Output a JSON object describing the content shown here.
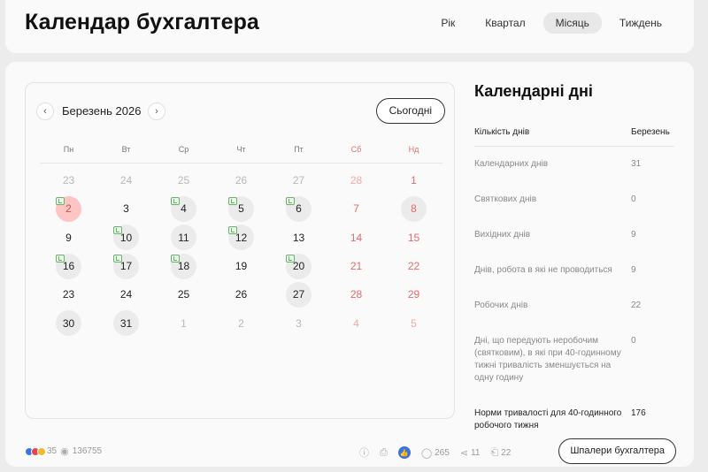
{
  "header": {
    "title": "Календар бухгалтера",
    "tabs": [
      {
        "label": "Рік",
        "active": false
      },
      {
        "label": "Квартал",
        "active": false
      },
      {
        "label": "Місяць",
        "active": true
      },
      {
        "label": "Тиждень",
        "active": false
      }
    ]
  },
  "calendar": {
    "month_label": "Березень 2026",
    "prev_icon": "‹",
    "next_icon": "›",
    "today_label": "Сьогодні",
    "weekdays": [
      {
        "label": "Пн",
        "weekend": false
      },
      {
        "label": "Вт",
        "weekend": false
      },
      {
        "label": "Ср",
        "weekend": false
      },
      {
        "label": "Чт",
        "weekend": false
      },
      {
        "label": "Пт",
        "weekend": false
      },
      {
        "label": "Сб",
        "weekend": true
      },
      {
        "label": "Нд",
        "weekend": true
      }
    ],
    "weeks": [
      [
        {
          "d": "23",
          "other": true
        },
        {
          "d": "24",
          "other": true
        },
        {
          "d": "25",
          "other": true
        },
        {
          "d": "26",
          "other": true
        },
        {
          "d": "27",
          "other": true
        },
        {
          "d": "28",
          "other": true,
          "weekend": true
        },
        {
          "d": "1",
          "weekend": true
        }
      ],
      [
        {
          "d": "2",
          "selected": true,
          "mark": true
        },
        {
          "d": "3"
        },
        {
          "d": "4",
          "shaded": true,
          "mark": true
        },
        {
          "d": "5",
          "shaded": true,
          "mark": true
        },
        {
          "d": "6",
          "shaded": true,
          "mark": true
        },
        {
          "d": "7",
          "weekend": true
        },
        {
          "d": "8",
          "weekend": true,
          "shaded": true
        }
      ],
      [
        {
          "d": "9"
        },
        {
          "d": "10",
          "shaded": true,
          "mark": true
        },
        {
          "d": "11",
          "shaded": true
        },
        {
          "d": "12",
          "shaded": true,
          "mark": true
        },
        {
          "d": "13"
        },
        {
          "d": "14",
          "weekend": true
        },
        {
          "d": "15",
          "weekend": true
        }
      ],
      [
        {
          "d": "16",
          "shaded": true,
          "mark": true
        },
        {
          "d": "17",
          "shaded": true,
          "mark": true
        },
        {
          "d": "18",
          "shaded": true,
          "mark": true
        },
        {
          "d": "19"
        },
        {
          "d": "20",
          "shaded": true,
          "mark": true
        },
        {
          "d": "21",
          "weekend": true
        },
        {
          "d": "22",
          "weekend": true
        }
      ],
      [
        {
          "d": "23"
        },
        {
          "d": "24"
        },
        {
          "d": "25"
        },
        {
          "d": "26"
        },
        {
          "d": "27",
          "shaded": true
        },
        {
          "d": "28",
          "weekend": true
        },
        {
          "d": "29",
          "weekend": true
        }
      ],
      [
        {
          "d": "30",
          "shaded": true
        },
        {
          "d": "31",
          "shaded": true
        },
        {
          "d": "1",
          "other": true
        },
        {
          "d": "2",
          "other": true
        },
        {
          "d": "3",
          "other": true
        },
        {
          "d": "4",
          "other": true,
          "weekend": true
        },
        {
          "d": "5",
          "other": true,
          "weekend": true
        }
      ]
    ]
  },
  "sidebar": {
    "title": "Календарні дні",
    "col_label": "Кількість днів",
    "col_month": "Березень",
    "rows": [
      {
        "label": "Календарних днів",
        "value": "31",
        "bold": false
      },
      {
        "label": "Святкових днів",
        "value": "0",
        "bold": false
      },
      {
        "label": "Вихідних днів",
        "value": "9",
        "bold": false
      },
      {
        "label": "Днів, робота в які не проводиться",
        "value": "9",
        "bold": false
      },
      {
        "label": "Робочих днів",
        "value": "22",
        "bold": false
      },
      {
        "label": "Дні, що передують неробочим (святковим), в які при 40-годинному тижні тривалість зменшується на одну годину",
        "value": "0",
        "bold": false
      },
      {
        "label": "Норми тривалості для 40-годинного робочого тижня",
        "value": "176",
        "bold": true
      }
    ]
  },
  "footer": {
    "reactions_count": "35",
    "views_count": "136755",
    "comments_count": "265",
    "shares_count": "11",
    "bookmarks_count": "22",
    "wallpaper_label": "Шпалери бухгалтера",
    "icons": {
      "view": "◉",
      "info": "ⓘ",
      "print": "⎙",
      "like": "👍",
      "comment": "◯",
      "share": "⋖",
      "bookmark": "⎗"
    },
    "reaction_colors": [
      "#3b73e0",
      "#e8424b",
      "#f5b829"
    ]
  }
}
